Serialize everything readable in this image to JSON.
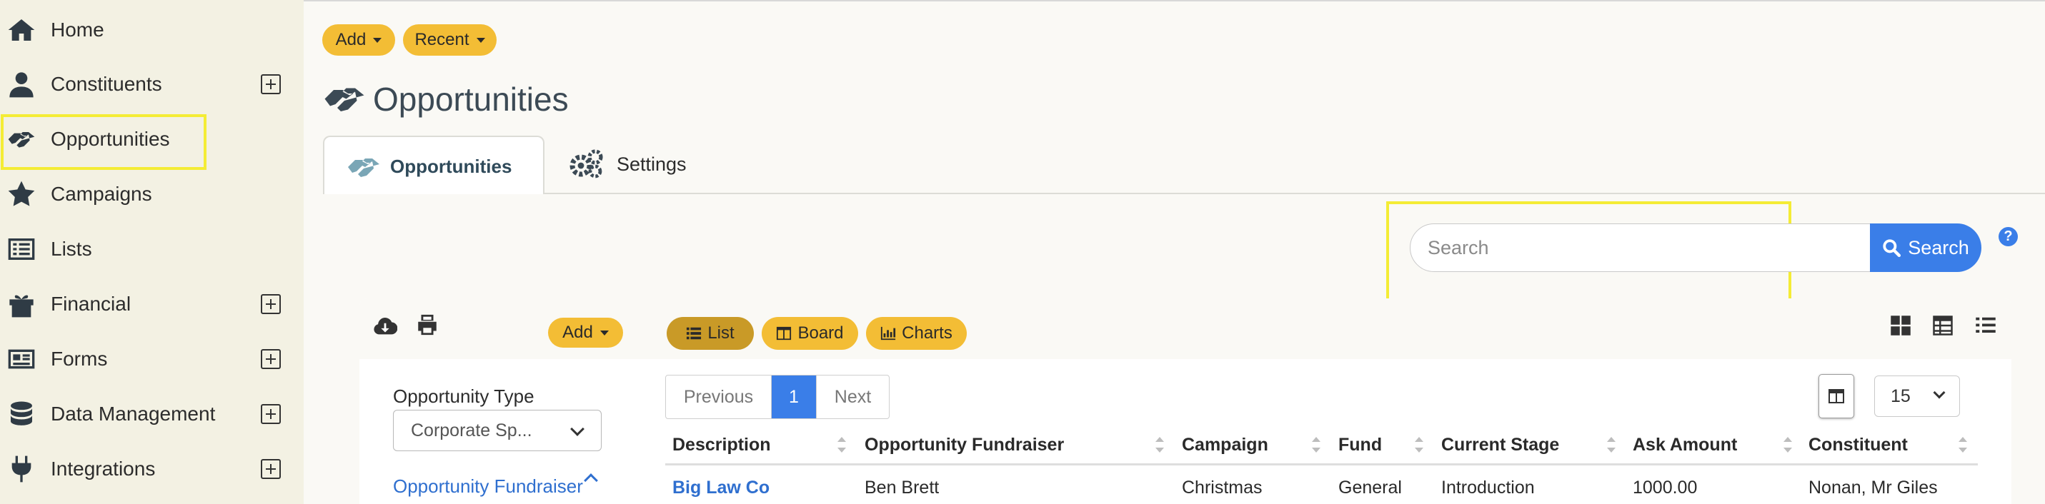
{
  "sidebar": {
    "items": [
      {
        "label": "Home",
        "icon": "home-icon",
        "expandable": false
      },
      {
        "label": "Constituents",
        "icon": "person-icon",
        "expandable": true
      },
      {
        "label": "Opportunities",
        "icon": "handshake-icon",
        "expandable": false
      },
      {
        "label": "Campaigns",
        "icon": "star-icon",
        "expandable": false
      },
      {
        "label": "Lists",
        "icon": "list-icon",
        "expandable": false
      },
      {
        "label": "Financial",
        "icon": "gift-icon",
        "expandable": true
      },
      {
        "label": "Forms",
        "icon": "form-icon",
        "expandable": true
      },
      {
        "label": "Data Management",
        "icon": "database-icon",
        "expandable": true
      },
      {
        "label": "Integrations",
        "icon": "plug-icon",
        "expandable": true
      }
    ]
  },
  "header": {
    "add_label": "Add",
    "recent_label": "Recent",
    "title": "Opportunities"
  },
  "tabs": [
    {
      "label": "Opportunities",
      "active": true
    },
    {
      "label": "Settings",
      "active": false
    }
  ],
  "search": {
    "placeholder": "Search",
    "button_label": "Search",
    "help": "?"
  },
  "card": {
    "add_label": "Add",
    "views": [
      {
        "label": "List",
        "active": true
      },
      {
        "label": "Board",
        "active": false
      },
      {
        "label": "Charts",
        "active": false
      }
    ],
    "filters": {
      "type_label": "Opportunity Type",
      "type_value": "Corporate Sp...",
      "fundraiser_label": "Opportunity Fundraiser"
    },
    "pager": {
      "previous": "Previous",
      "current": "1",
      "next": "Next"
    },
    "page_size": "15",
    "columns": [
      "Description",
      "Opportunity Fundraiser",
      "Campaign",
      "Fund",
      "Current Stage",
      "Ask Amount",
      "Constituent"
    ],
    "rows": [
      [
        "Big Law Co",
        "Ben Brett",
        "Christmas",
        "General",
        "Introduction",
        "1000.00",
        "Nonan, Mr Giles"
      ]
    ]
  },
  "colors": {
    "accent_yellow": "#f3bd35",
    "primary_blue": "#3a7ee8",
    "highlight": "#f4ec35",
    "sidebar_bg": "#f3f1e3"
  }
}
